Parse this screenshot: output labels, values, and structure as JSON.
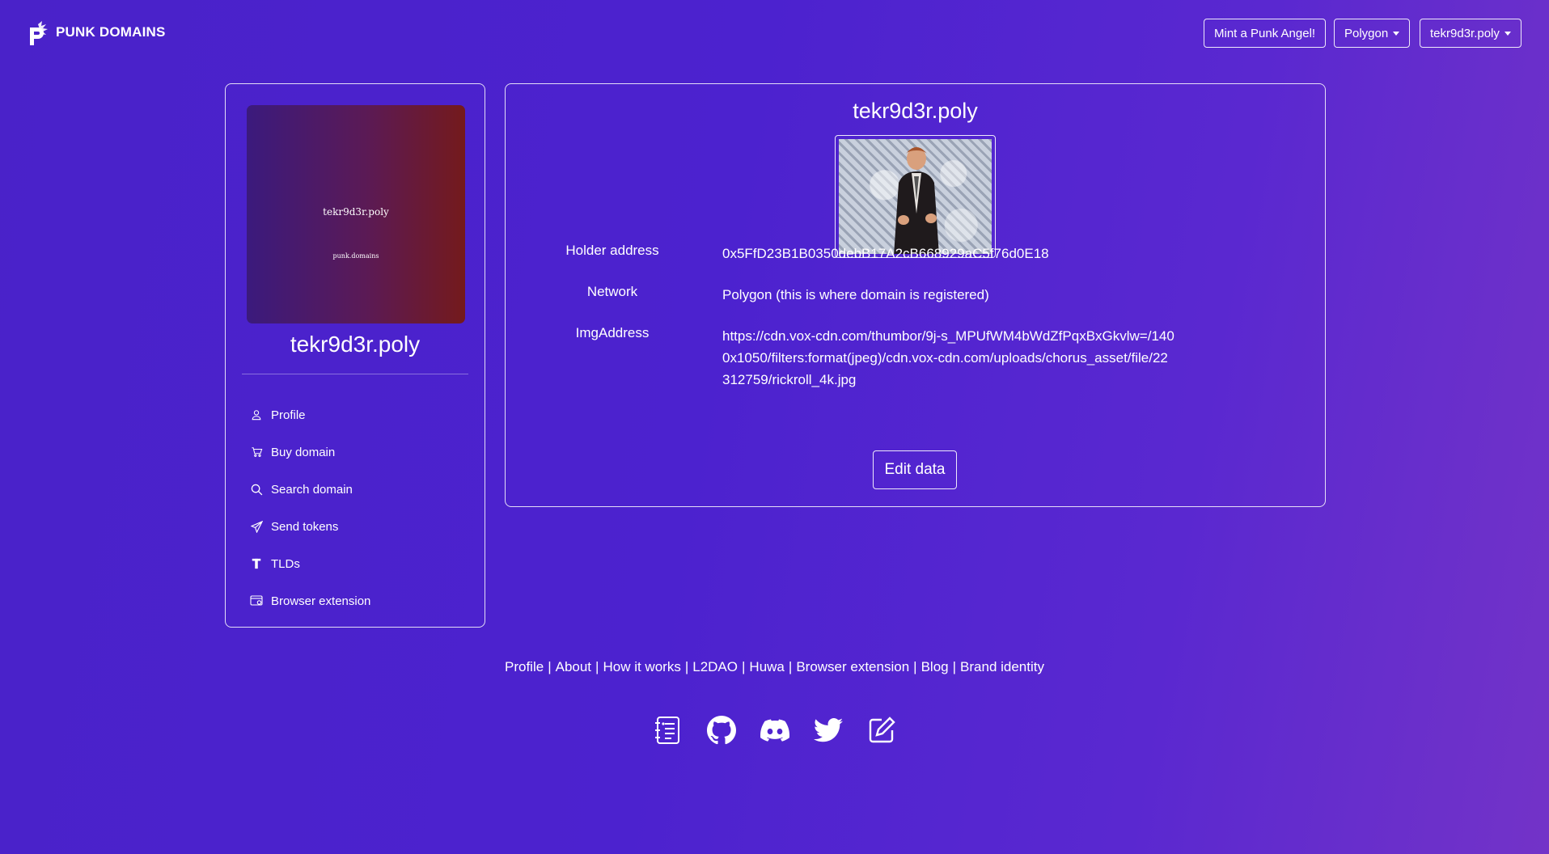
{
  "nav": {
    "brand": "PUNK DOMAINS",
    "mint_label": "Mint a Punk Angel!",
    "network_label": "Polygon",
    "account_label": "tekr9d3r.poly"
  },
  "sidebar": {
    "nft_name": "tekr9d3r.poly",
    "nft_sub": "punk.domains",
    "title": "tekr9d3r.poly",
    "items": [
      {
        "label": "Profile",
        "icon": "person-icon"
      },
      {
        "label": "Buy domain",
        "icon": "cart-icon"
      },
      {
        "label": "Search domain",
        "icon": "search-icon"
      },
      {
        "label": "Send tokens",
        "icon": "send-icon"
      },
      {
        "label": "TLDs",
        "icon": "tld-icon"
      },
      {
        "label": "Browser extension",
        "icon": "browser-extension-icon"
      }
    ]
  },
  "main": {
    "title": "tekr9d3r.poly",
    "rows": [
      {
        "key": "Holder address",
        "value": "0x5FfD23B1B0350debB17A2cB668929aC5f76d0E18"
      },
      {
        "key": "Network",
        "value": "Polygon (this is where domain is registered)"
      },
      {
        "key": "ImgAddress",
        "value": "https://cdn.vox-cdn.com/thumbor/9j-s_MPUfWM4bWdZfPqxBxGkvlw=/1400x1050/filters:format(jpeg)/cdn.vox-cdn.com/uploads/chorus_asset/file/22312759/rickroll_4k.jpg"
      }
    ],
    "edit_label": "Edit data"
  },
  "footer": {
    "links": [
      "Profile",
      "About",
      "How it works",
      "L2DAO",
      "Huwa",
      "Browser extension",
      "Blog",
      "Brand identity"
    ],
    "separator": "|",
    "icons": [
      "docs-icon",
      "github-icon",
      "discord-icon",
      "twitter-icon",
      "edit-icon"
    ]
  },
  "colors": {
    "background": "#4c22cf",
    "accent": "#ffffff",
    "nft_gradient_start": "#3b1a7d",
    "nft_gradient_end": "#741a1c"
  }
}
